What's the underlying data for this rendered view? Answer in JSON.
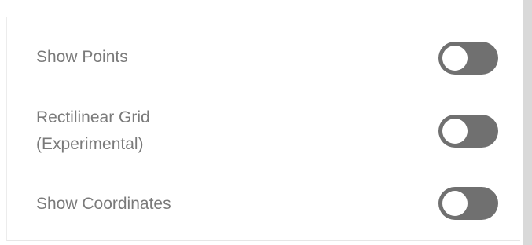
{
  "settings": {
    "items": [
      {
        "label": "Show Points",
        "toggle_on": false
      },
      {
        "label": "Rectilinear Grid\n(Experimental)",
        "toggle_on": false
      },
      {
        "label": "Show Coordinates",
        "toggle_on": false
      }
    ]
  },
  "colors": {
    "label_text": "#7a7a7a",
    "toggle_off_track": "#707070",
    "toggle_knob": "#ffffff",
    "scrollbar": "#d9d9d9"
  }
}
